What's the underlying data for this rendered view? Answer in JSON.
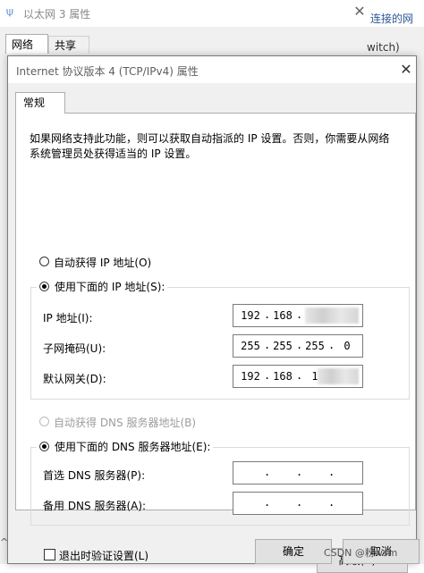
{
  "back_window": {
    "title": "以太网 3 属性",
    "tabs": [
      "网络",
      "共享"
    ],
    "right_text_top": "连接的网",
    "right_text_second": "witch)",
    "close_glyph": "✕",
    "left_bottom_glyph": "^"
  },
  "dialog": {
    "title": "Internet 协议版本 4 (TCP/IPv4) 属性",
    "close_glyph": "✕",
    "tab_general": "常规",
    "description": "如果网络支持此功能，则可以获取自动指派的 IP 设置。否则，你需要从网络系统管理员处获得适当的 IP 设置。",
    "ip_section": {
      "auto_option": "自动获得 IP 地址(O)",
      "manual_option": "使用下面的 IP 地址(S):",
      "selected": "manual",
      "fields": [
        {
          "label": "IP 地址(I):",
          "segments": [
            "192",
            "168",
            "",
            ""
          ]
        },
        {
          "label": "子网掩码(U):",
          "segments": [
            "255",
            "255",
            "255",
            "0"
          ]
        },
        {
          "label": "默认网关(D):",
          "segments": [
            "192",
            "168",
            "1",
            ""
          ]
        }
      ]
    },
    "dns_section": {
      "auto_option": "自动获得 DNS 服务器地址(B)",
      "manual_option": "使用下面的 DNS 服务器地址(E):",
      "selected": "manual",
      "auto_disabled": true,
      "fields": [
        {
          "label": "首选 DNS 服务器(P):",
          "segments": [
            "",
            "",
            "",
            ""
          ]
        },
        {
          "label": "备用 DNS 服务器(A):",
          "segments": [
            "",
            "",
            "",
            ""
          ]
        }
      ]
    },
    "validate_checkbox": {
      "label": "退出时验证设置(L)",
      "checked": false
    },
    "advanced_button": "高级(V)...",
    "ok_button": "确定",
    "cancel_button": "取消"
  },
  "watermark": "CSDN @粉wsm"
}
